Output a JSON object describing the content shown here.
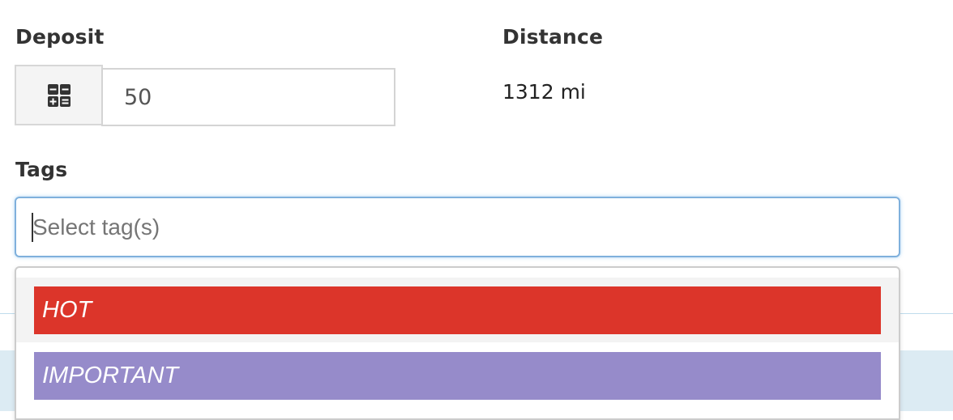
{
  "deposit": {
    "label": "Deposit",
    "value": "50",
    "addon_icon": "calculator-icon"
  },
  "distance": {
    "label": "Distance",
    "value": "1312 mi"
  },
  "tags": {
    "label": "Tags",
    "placeholder": "Select tag(s)",
    "options": [
      {
        "label": "HOT",
        "color": "#dc352a",
        "highlighted": true
      },
      {
        "label": "IMPORTANT",
        "color": "#968bca",
        "highlighted": false
      }
    ]
  },
  "colors": {
    "focus_border": "#7fb0dc",
    "label_text": "#333333",
    "page_band": "#dcebf3"
  }
}
